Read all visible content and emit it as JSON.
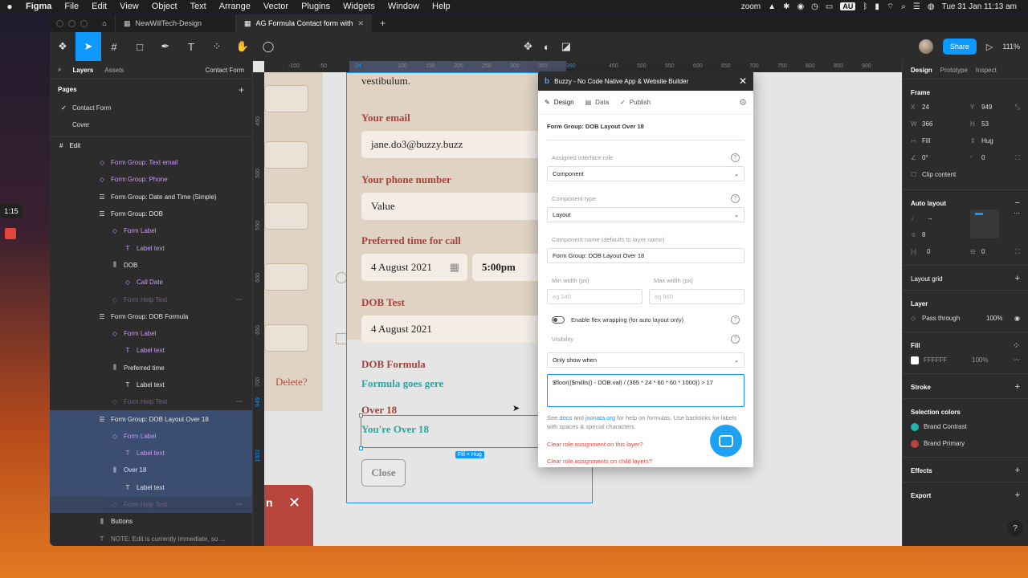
{
  "menubar": {
    "app": "Figma",
    "items": [
      "File",
      "Edit",
      "View",
      "Object",
      "Text",
      "Arrange",
      "Vector",
      "Plugins",
      "Widgets",
      "Window",
      "Help"
    ],
    "zoom_app": "zoom",
    "lang": "AU",
    "datetime": "Tue 31 Jan  11:13 am"
  },
  "sidebar_timer": "1:15",
  "tabs": [
    {
      "label": "NewWillTech-Design"
    },
    {
      "label": "AG Formula Contact form with results v"
    }
  ],
  "toolbar": {
    "share": "Share",
    "zoom": "111%"
  },
  "left_panel": {
    "tabs": [
      "Layers",
      "Assets"
    ],
    "page_selector": "Contact Form",
    "pages_heading": "Pages",
    "pages": [
      "Contact Form",
      "Cover"
    ],
    "edit_label": "Edit",
    "layers": [
      {
        "label": "Form Group: Text email",
        "style": "purple",
        "indent": 60,
        "icon": "◇"
      },
      {
        "label": "Form Group: Phone",
        "style": "purple",
        "indent": 60,
        "icon": "◇"
      },
      {
        "label": "Form Group: Date and Time (Simple)",
        "style": "white",
        "indent": 60,
        "icon": "☰"
      },
      {
        "label": "Form Group: DOB",
        "style": "white",
        "indent": 60,
        "icon": "☰"
      },
      {
        "label": "Form Label",
        "style": "purple",
        "indent": 76,
        "icon": "◇"
      },
      {
        "label": "Label text",
        "style": "purple",
        "indent": 92,
        "icon": "T"
      },
      {
        "label": "DOB",
        "style": "white",
        "indent": 76,
        "icon": "⫼"
      },
      {
        "label": "Call Date",
        "style": "purple",
        "indent": 92,
        "icon": "◇"
      },
      {
        "label": "Form Help Text",
        "style": "dim",
        "indent": 76,
        "icon": "◇",
        "eye": true
      },
      {
        "label": "Form Group: DOB Formula",
        "style": "white",
        "indent": 60,
        "icon": "☰"
      },
      {
        "label": "Form Label",
        "style": "purple",
        "indent": 76,
        "icon": "◇"
      },
      {
        "label": "Label text",
        "style": "purple",
        "indent": 92,
        "icon": "T"
      },
      {
        "label": "Preferred time",
        "style": "white",
        "indent": 76,
        "icon": "⫼"
      },
      {
        "label": "Label text",
        "style": "white",
        "indent": 92,
        "icon": "T"
      },
      {
        "label": "Form Help Text",
        "style": "dim",
        "indent": 76,
        "icon": "◇",
        "eye": true
      },
      {
        "label": "Form Group: DOB Layout Over 18",
        "style": "white",
        "indent": 60,
        "icon": "☰",
        "selected": true
      },
      {
        "label": "Form Label",
        "style": "purple",
        "indent": 76,
        "icon": "◇",
        "selected": true
      },
      {
        "label": "Label text",
        "style": "purple",
        "indent": 92,
        "icon": "T",
        "selected": true
      },
      {
        "label": "Over 18",
        "style": "white",
        "indent": 76,
        "icon": "⫼",
        "selected": true
      },
      {
        "label": "Label text",
        "style": "white",
        "indent": 92,
        "icon": "T",
        "selected": true
      },
      {
        "label": "Form Help Text",
        "style": "dim",
        "indent": 76,
        "icon": "◇",
        "eye": true,
        "selected": true
      },
      {
        "label": "Buttons",
        "style": "white",
        "indent": 60,
        "icon": "⫼"
      },
      {
        "label": "NOTE: Edit is currently immediate, so ...",
        "style": "gray",
        "indent": 60,
        "icon": "T"
      }
    ]
  },
  "canvas": {
    "ruler_top": [
      "-100",
      "-50",
      "24",
      "100",
      "150",
      "200",
      "250",
      "300",
      "350",
      "390",
      "450",
      "500",
      "550",
      "600",
      "650",
      "700",
      "750",
      "800",
      "850",
      "900"
    ],
    "ruler_left": [
      "450",
      "500",
      "550",
      "600",
      "650",
      "700",
      "750",
      "800",
      "949",
      "1002"
    ],
    "delete_label": "Delete?",
    "modal_letter": "n",
    "form": {
      "partial_text": "vestibulum.",
      "email_label": "Your email",
      "email_value": "jane.do3@buzzy.buzz",
      "phone_label": "Your phone number",
      "phone_value": "Value",
      "time_label": "Preferred time for call",
      "date_value": "4 August 2021",
      "time_value": "5:00pm",
      "dob_label": "DOB Test",
      "dob_value": "4 August 2021",
      "formula_label": "DOB Formula",
      "formula_value": "Formula goes gere",
      "over_label": "Over 18",
      "over_value": "You're Over 18",
      "close": "Close"
    },
    "fill_hug": "Fill × Hug"
  },
  "plugin": {
    "title": "Buzzy - No Code Native App & Website Builder",
    "tabs": [
      "Design",
      "Data",
      "Publish"
    ],
    "layer_title": "Form Group: DOB Layout Over 18",
    "role_label": "Assigned interface role",
    "role_value": "Component",
    "type_label": "Component type",
    "type_value": "Layout",
    "name_label": "Component name (defaults to layer name)",
    "name_value": "Form Group: DOB Layout Over 18",
    "min_label": "Min width (px)",
    "min_placeholder": "eg 240",
    "max_label": "Max width (px)",
    "max_placeholder": "eg 960",
    "flex_label": "Enable flex wrapping (for auto layout only)",
    "visibility_label": "Visibility",
    "visibility_value": "Only show when",
    "formula": "$floor(($millis() - DOB.val) / (365 * 24 * 60 * 60 * 1000)) > 17",
    "help_pre": "See ",
    "help_docs": "docs",
    "help_mid": " and ",
    "help_jsonata": "jsonata.org",
    "help_post": " for help on formulas. Use backticks for labels with spaces & special characters.",
    "clear_role": "Clear role assignment on this layer?",
    "clear_child": "Clear role assignments on child layers?"
  },
  "right_panel": {
    "tabs": [
      "Design",
      "Prototype",
      "Inspect"
    ],
    "frame": "Frame",
    "x": "24",
    "y": "949",
    "w": "366",
    "h": "53",
    "fill": "Fill",
    "hug": "Hug",
    "rotation": "0°",
    "radius": "0",
    "clip": "Clip content",
    "auto_layout": "Auto layout",
    "gap": "8",
    "pad_h": "0",
    "pad_v": "0",
    "layout_grid": "Layout grid",
    "layer": "Layer",
    "blend": "Pass through",
    "opacity": "100%",
    "fill_h": "Fill",
    "fill_hex": "FFFFFF",
    "fill_opacity": "100%",
    "stroke": "Stroke",
    "selection_colors": "Selection colors",
    "colors": [
      {
        "name": "Brand Contrast",
        "hex": "#1fb5ad"
      },
      {
        "name": "Brand Primary",
        "hex": "#b8453c"
      }
    ],
    "effects": "Effects",
    "export": "Export"
  }
}
